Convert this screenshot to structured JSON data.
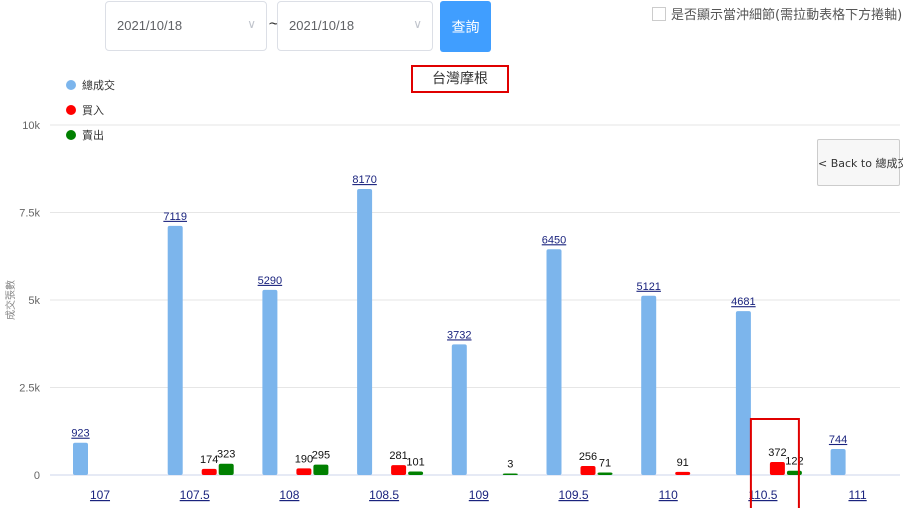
{
  "filters": {
    "start_date": "2021/10/18",
    "end_date": "2021/10/18",
    "separator": "~",
    "query_label": "查詢",
    "offset_toggle_label": "是否顯示當沖細節(需拉動表格下方捲軸)"
  },
  "back_button_label": "< Back to 總成交",
  "chart_data": {
    "type": "bar",
    "title": "台灣摩根",
    "ylabel": "成交張數",
    "xlabel": "",
    "ylim": [
      0,
      10000
    ],
    "yticks": [
      0,
      2500,
      5000,
      7500,
      10000
    ],
    "ytick_labels": [
      "0",
      "2.5k",
      "5k",
      "7.5k",
      "10k"
    ],
    "grid": true,
    "legend_position": "top-left",
    "categories": [
      "107",
      "107.5",
      "108",
      "108.5",
      "109",
      "109.5",
      "110",
      "110.5",
      "111"
    ],
    "series": [
      {
        "name": "總成交",
        "color": "#7cb5ec",
        "values": [
          923,
          7119,
          5290,
          8170,
          3732,
          6450,
          5121,
          4681,
          744
        ]
      },
      {
        "name": "買入",
        "color": "#ff0000",
        "values": [
          null,
          174,
          190,
          281,
          null,
          256,
          91,
          372,
          null
        ]
      },
      {
        "name": "賣出",
        "color": "#008000",
        "values": [
          null,
          323,
          295,
          101,
          3,
          71,
          null,
          122,
          null
        ]
      }
    ],
    "highlight_category": "110.5"
  }
}
